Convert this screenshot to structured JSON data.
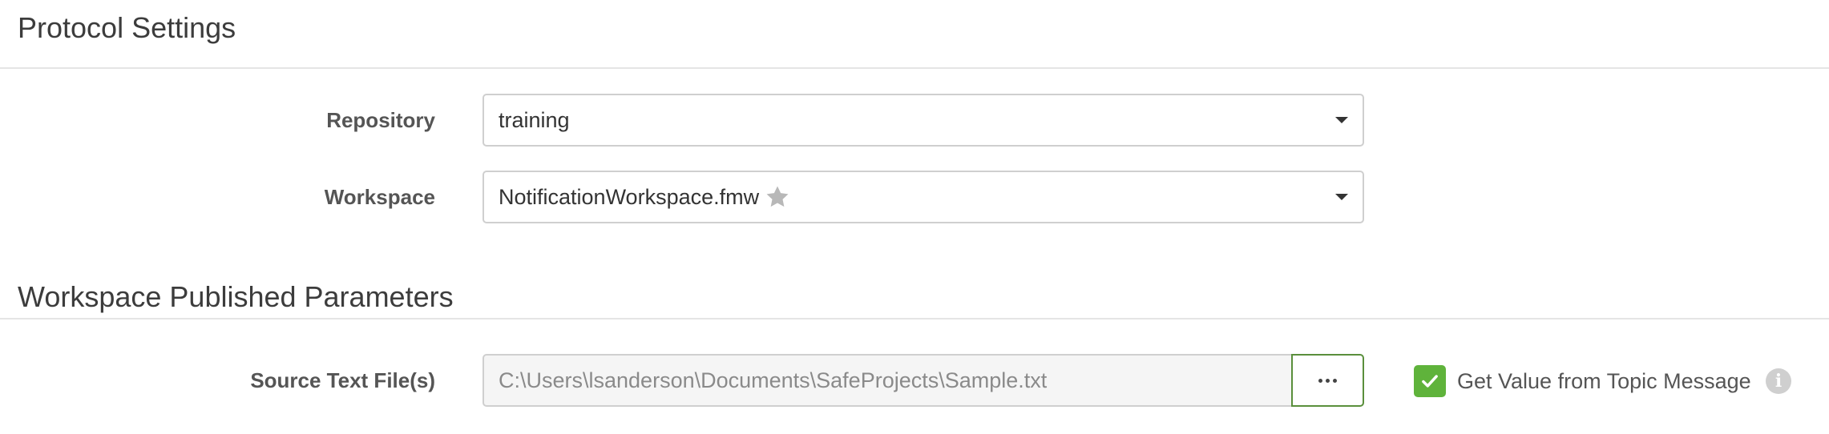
{
  "protocol_settings": {
    "title": "Protocol Settings",
    "repository": {
      "label": "Repository",
      "value": "training"
    },
    "workspace": {
      "label": "Workspace",
      "value": "NotificationWorkspace.fmw",
      "favorite_icon": "star-icon"
    }
  },
  "published_parameters": {
    "title": "Workspace Published Parameters",
    "source_text_files": {
      "label": "Source Text File(s)",
      "value": "C:\\Users\\lsanderson\\Documents\\SafeProjects\\Sample.txt",
      "browse_icon": "ellipsis-icon"
    },
    "topic_message": {
      "label": "Get Value from Topic Message",
      "checked": true,
      "info_icon": "info-icon"
    }
  },
  "colors": {
    "accent_green": "#5fb33b",
    "browse_border": "#5a8f3c",
    "field_border": "#cfcfcf",
    "disabled_bg": "#f5f5f5"
  }
}
